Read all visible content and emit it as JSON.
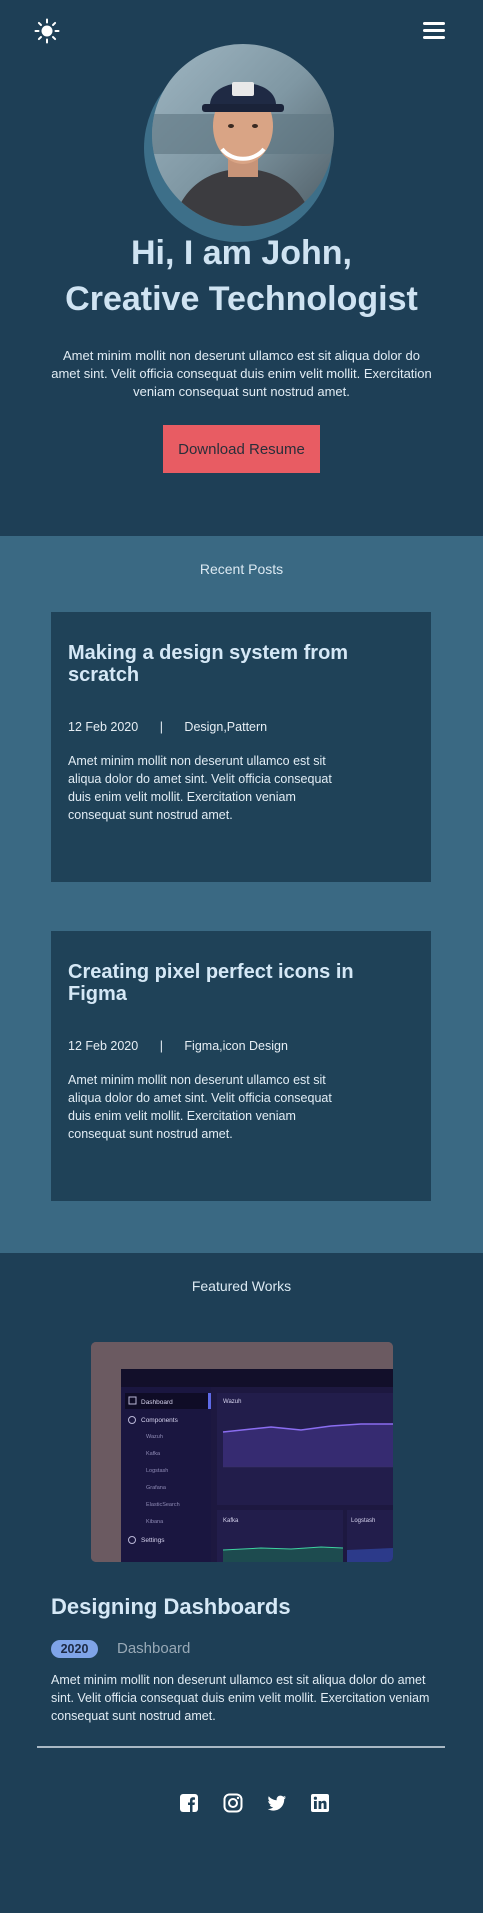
{
  "header": {
    "theme_icon": "sun-icon",
    "menu_icon": "hamburger-menu-icon"
  },
  "hero": {
    "title_line1": "Hi, I am John,",
    "title_line2": "Creative Technologist",
    "intro": "Amet minim mollit non deserunt ullamco est sit aliqua dolor do amet sint. Velit officia consequat duis enim velit mollit. Exercitation veniam consequat sunt nostrud amet.",
    "button_label": "Download Resume"
  },
  "recent_posts": {
    "heading": "Recent Posts",
    "posts": [
      {
        "title": "Making a design system from scratch",
        "date": "12 Feb 2020",
        "separator": "|",
        "tags": "Design,Pattern",
        "excerpt": "Amet minim mollit non deserunt ullamco est sit aliqua dolor do amet sint. Velit officia consequat duis enim velit mollit. Exercitation veniam consequat sunt nostrud amet."
      },
      {
        "title": "Creating pixel perfect icons in Figma",
        "date": "12 Feb 2020",
        "separator": "|",
        "tags": "Figma,icon Design",
        "excerpt": "Amet minim mollit non deserunt ullamco est sit aliqua dolor do amet sint. Velit officia consequat duis enim velit mollit. Exercitation veniam consequat sunt nostrud amet."
      }
    ]
  },
  "featured_works": {
    "heading": "Featured Works",
    "work": {
      "title": "Designing Dashboards",
      "year": "2020",
      "tag": "Dashboard",
      "description": "Amet minim mollit non deserunt ullamco est sit aliqua dolor do amet sint. Velit officia consequat duis enim velit mollit. Exercitation veniam consequat sunt nostrud amet.",
      "thumbnail": {
        "sidebar": [
          "Dashboard",
          "Components",
          "Wazuh",
          "Kafka",
          "Logstash",
          "Grafana",
          "ElasticSearch",
          "Kibana",
          "Settings"
        ],
        "panel_main": "Wazuh",
        "panel_kafka": "Kafka",
        "panel_logstash": "Logstash"
      }
    }
  },
  "footer": {
    "social": [
      "facebook-icon",
      "instagram-icon",
      "twitter-icon",
      "linkedin-icon"
    ]
  },
  "colors": {
    "background_dark": "#1e3f56",
    "background_light": "#3a6983",
    "accent_button": "#e85c63",
    "year_badge": "#7fa4e8"
  }
}
